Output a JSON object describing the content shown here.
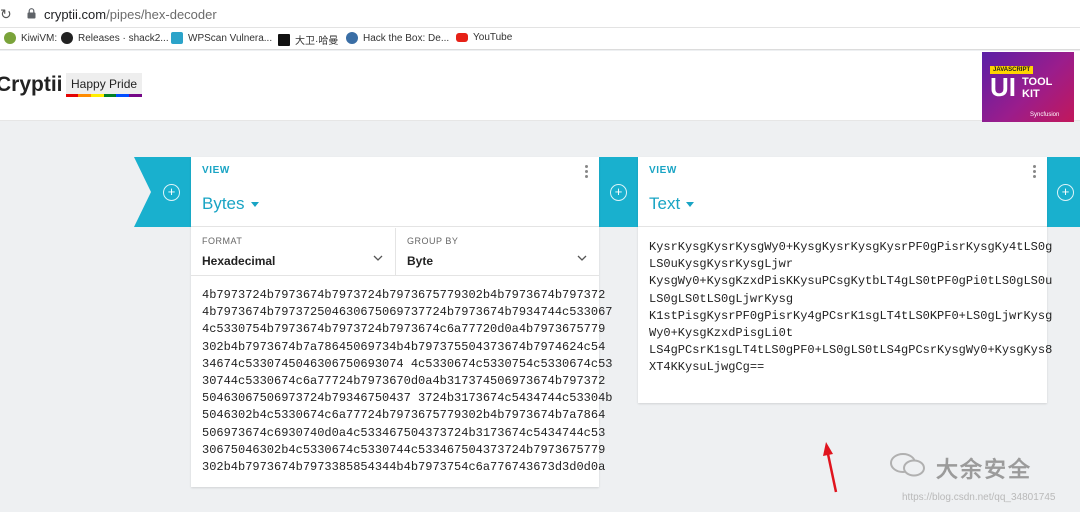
{
  "browser": {
    "url_host": "cryptii.com",
    "url_path": "/pipes/hex-decoder",
    "bookmarks": [
      {
        "label": "KiwiVM:",
        "icon": "kiwivm-icon",
        "color": "#7aa33a"
      },
      {
        "label": "Releases · shack2...",
        "icon": "github-icon",
        "color": "#222222"
      },
      {
        "label": "WPScan Vulnera...",
        "icon": "wpscan-icon",
        "color": "#2ba3c9"
      },
      {
        "label": "大卫·哈曼",
        "icon": "dh-icon",
        "color": "#111111"
      },
      {
        "label": "Hack the Box: De...",
        "icon": "wordpress-icon",
        "color": "#3a6ea5"
      },
      {
        "label": "YouTube",
        "icon": "youtube-icon",
        "color": "#e62117"
      }
    ]
  },
  "header": {
    "brand": "Cryptii",
    "pride_button": "Happy Pride"
  },
  "ad": {
    "tag": "JAVASCRIPT",
    "big": "UI",
    "line1": "TOOL",
    "line2": "KIT",
    "brand": "Syncfusion"
  },
  "left_panel": {
    "kicker": "VIEW",
    "title": "Bytes",
    "format_label": "FORMAT",
    "format_value": "Hexadecimal",
    "group_label": "GROUP BY",
    "group_value": "Byte",
    "hex_lines": [
      "4b7973724b7973674b7973724b7973675779302b4b7973674b797372",
      "4b7973674b797372504630675069737724b7973674b7934744c533067",
      "4c5330754b7973674b7973724b7973674c6a77720d0a4b7973675779",
      "302b4b7973674b7a78645069734b4b797375504373674b7974624c54",
      "34674c5330745046306750693074 4c5330674c5330754c5330674c53",
      "30744c5330674c6a77724b7973670d0a4b317374506973674b797372",
      "50463067506973724b79346750437 3724b3173674c5434744c53304b",
      "5046302b4c5330674c6a77724b7973675779302b4b7973674b7a7864",
      "506973674c6930740d0a4c533467504373724b3173674c5434744c53",
      "30675046302b4c5330674c5330744c533467504373724b7973675779",
      "302b4b7973674b7973385854344b4b7973754c6a776743673d3d0d0a"
    ]
  },
  "right_panel": {
    "kicker": "VIEW",
    "title": "Text",
    "text_lines": [
      "KysrKysgKysrKysgWy0+KysgKysrKysgKysrPF0gPisrKysgKy4tLS0g",
      "LS0uKysgKysrKysgLjwr",
      "KysgWy0+KysgKzxdPisKKysuPCsgKytbLT4gLS0tPF0gPi0tLS0gLS0u",
      "LS0gLS0tLS0gLjwrKysg",
      "K1stPisgKysrPF0gPisrKy4gPCsrK1sgLT4tLS0KPF0+LS0gLjwrKysg",
      "Wy0+KysgKzxdPisgLi0t",
      "LS4gPCsrK1sgLT4tLS0gPF0+LS0gLS0tLS4gPCsrKysgWy0+KysgKys8",
      "XT4KKysuLjwgCg=="
    ]
  },
  "watermark": {
    "name": "大余安全",
    "url": "https://blog.csdn.net/qq_34801745"
  },
  "colors": {
    "accent": "#19a4c4",
    "connector": "#19b0ce",
    "annotation_arrow": "#e0141e"
  }
}
